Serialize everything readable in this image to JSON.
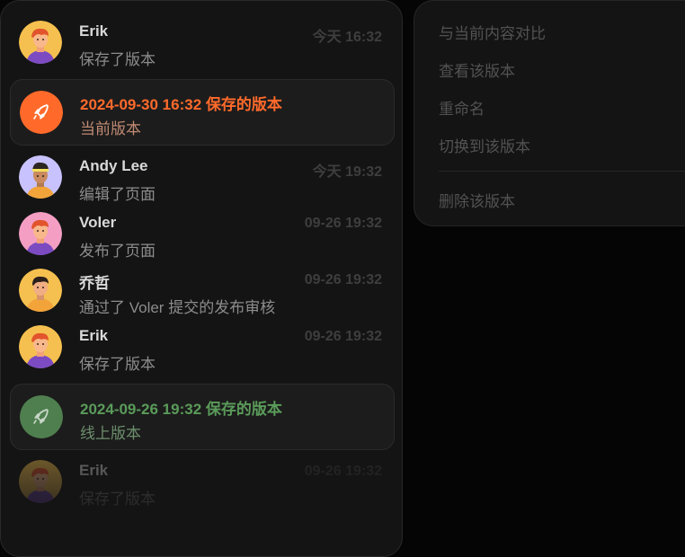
{
  "history": {
    "entries": [
      {
        "type": "activity",
        "name": "Erik",
        "action": "保存了版本",
        "time": "今天 16:32",
        "avatar": "red-hair-avatar"
      },
      {
        "type": "version",
        "title": "2024-09-30 16:32 保存的版本",
        "subtitle": "当前版本",
        "color": "#ff6a2b",
        "icon": "rocket-icon"
      },
      {
        "type": "activity",
        "name": "Andy Lee",
        "action": "编辑了页面",
        "time": "今天 19:32",
        "avatar": "headband-avatar"
      },
      {
        "type": "activity",
        "name": "Voler",
        "action": "发布了页面",
        "time": "09-26 19:32",
        "avatar": "red-hair-avatar"
      },
      {
        "type": "activity",
        "name": "乔哲",
        "action": "通过了 Voler 提交的发布审核",
        "time": "09-26 19:32",
        "avatar": "dark-hair-avatar"
      },
      {
        "type": "activity",
        "name": "Erik",
        "action": "保存了版本",
        "time": "09-26 19:32",
        "avatar": "red-hair-avatar"
      },
      {
        "type": "version",
        "title": "2024-09-26 19:32 保存的版本",
        "subtitle": "线上版本",
        "color": "#4f7f4f",
        "icon": "rocket-icon"
      },
      {
        "type": "activity",
        "name": "Erik",
        "action": "保存了版本",
        "time": "09-26 19:32",
        "avatar": "red-hair-avatar"
      }
    ]
  },
  "menu": {
    "items": [
      "与当前内容对比",
      "查看该版本",
      "重命名",
      "切换到该版本",
      "删除该版本"
    ]
  },
  "colors": {
    "avatar_yellow": "#f5c04f",
    "avatar_lavender": "#c8c2ff",
    "avatar_pink": "#f49ec4",
    "version_orange": "#ff6a2b",
    "version_green": "#4f7f4f"
  }
}
